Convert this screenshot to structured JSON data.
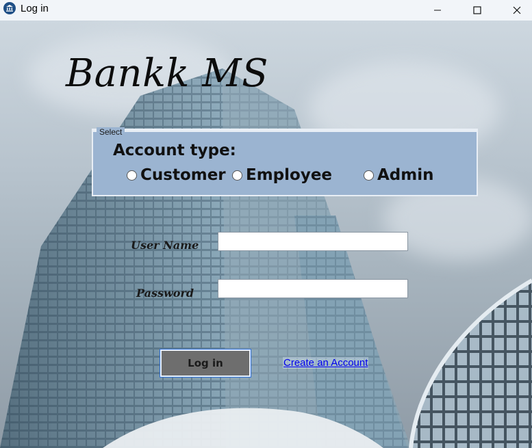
{
  "window": {
    "title": "Log in",
    "icon": "bank-icon",
    "controls": [
      "minimize-icon",
      "maximize-icon",
      "close-icon"
    ]
  },
  "app": {
    "title": "Bankk MS"
  },
  "account_group": {
    "legend": "Select",
    "heading": "Account type:",
    "options": [
      {
        "label": "Customer",
        "checked": false
      },
      {
        "label": "Employee",
        "checked": false
      },
      {
        "label": "Admin",
        "checked": false
      }
    ]
  },
  "form": {
    "username_label": "User Name",
    "username_value": "",
    "password_label": "Password",
    "password_value": "",
    "login_label": "Log in",
    "create_account_label": "Create an Account"
  },
  "colors": {
    "groupbox_bg": "#9bb4d1",
    "login_button_bg": "#6e6e6e",
    "link": "#0000ee"
  }
}
